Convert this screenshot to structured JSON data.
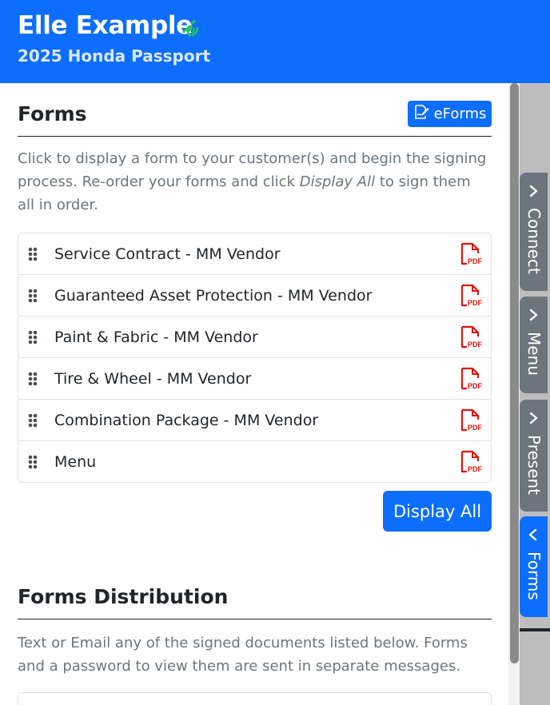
{
  "header": {
    "customer_name": "Elle Example",
    "vehicle": "2025 Honda Passport",
    "sync_icon": "satellite-signal-icon",
    "accent": "#0d6efd",
    "sync_color": "#22c55e"
  },
  "forms_section": {
    "title": "Forms",
    "eforms_label": "eForms",
    "eforms_icon": "signature-edit-icon",
    "intro_part1": "Click to display a form to your customer(s) and begin the signing process. Re-order your forms and click ",
    "intro_emphasis": "Display All",
    "intro_part2": " to sign them all in order.",
    "items": [
      {
        "label": "Service Contract - MM Vendor",
        "icon": "pdf-icon"
      },
      {
        "label": "Guaranteed Asset Protection - MM Vendor",
        "icon": "pdf-icon"
      },
      {
        "label": "Paint & Fabric - MM Vendor",
        "icon": "pdf-icon"
      },
      {
        "label": "Tire & Wheel - MM Vendor",
        "icon": "pdf-icon"
      },
      {
        "label": "Combination Package - MM Vendor",
        "icon": "pdf-icon"
      },
      {
        "label": "Menu",
        "icon": "pdf-icon"
      }
    ],
    "display_all_label": "Display All",
    "pdf_color": "#e3120b"
  },
  "distribution_section": {
    "title": "Forms Distribution",
    "intro": "Text or Email any of the signed documents listed below. Forms and a password to view them are sent in separate messages."
  },
  "side_tabs": [
    {
      "label": "Connect",
      "chevron": "chevron-right-icon",
      "active": false
    },
    {
      "label": "Menu",
      "chevron": "chevron-right-icon",
      "active": false
    },
    {
      "label": "Present",
      "chevron": "chevron-right-icon",
      "active": false
    },
    {
      "label": "Forms",
      "chevron": "chevron-left-icon",
      "active": true
    }
  ]
}
